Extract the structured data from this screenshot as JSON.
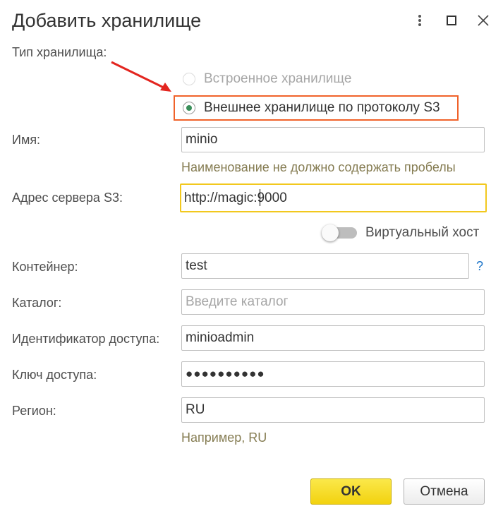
{
  "dialog": {
    "title": "Добавить хранилище",
    "icons": {
      "more": "more-vertical-icon",
      "maximize": "maximize-icon",
      "close": "close-icon"
    }
  },
  "storage_type": {
    "label": "Тип хранилища:",
    "options": [
      {
        "label": "Встроенное хранилище",
        "selected": false,
        "disabled": true
      },
      {
        "label": "Внешнее хранилище по протоколу S3",
        "selected": true,
        "disabled": false
      }
    ]
  },
  "form": {
    "name": {
      "label": "Имя:",
      "value": "minio",
      "hint": "Наименование не должно содержать пробелы"
    },
    "server": {
      "label": "Адрес сервера S3:",
      "value": "http://magic:9000"
    },
    "virtual_host": {
      "label": "Виртуальный хост",
      "on": false
    },
    "container": {
      "label": "Контейнер:",
      "value": "test",
      "help": "?"
    },
    "catalog": {
      "label": "Каталог:",
      "value": "",
      "placeholder": "Введите каталог"
    },
    "access_id": {
      "label": "Идентификатор доступа:",
      "value": "minioadmin"
    },
    "access_key": {
      "label": "Ключ доступа:",
      "value": "●●●●●●●●●●"
    },
    "region": {
      "label": "Регион:",
      "value": "RU",
      "hint": "Например, RU"
    }
  },
  "buttons": {
    "ok": "OK",
    "cancel": "Отмена"
  },
  "colors": {
    "highlight": "#f0622a",
    "arrow": "#e3251f",
    "ok_button": "#f5d90f",
    "focus_border": "#f2c81e",
    "hint_text": "#857c52"
  }
}
